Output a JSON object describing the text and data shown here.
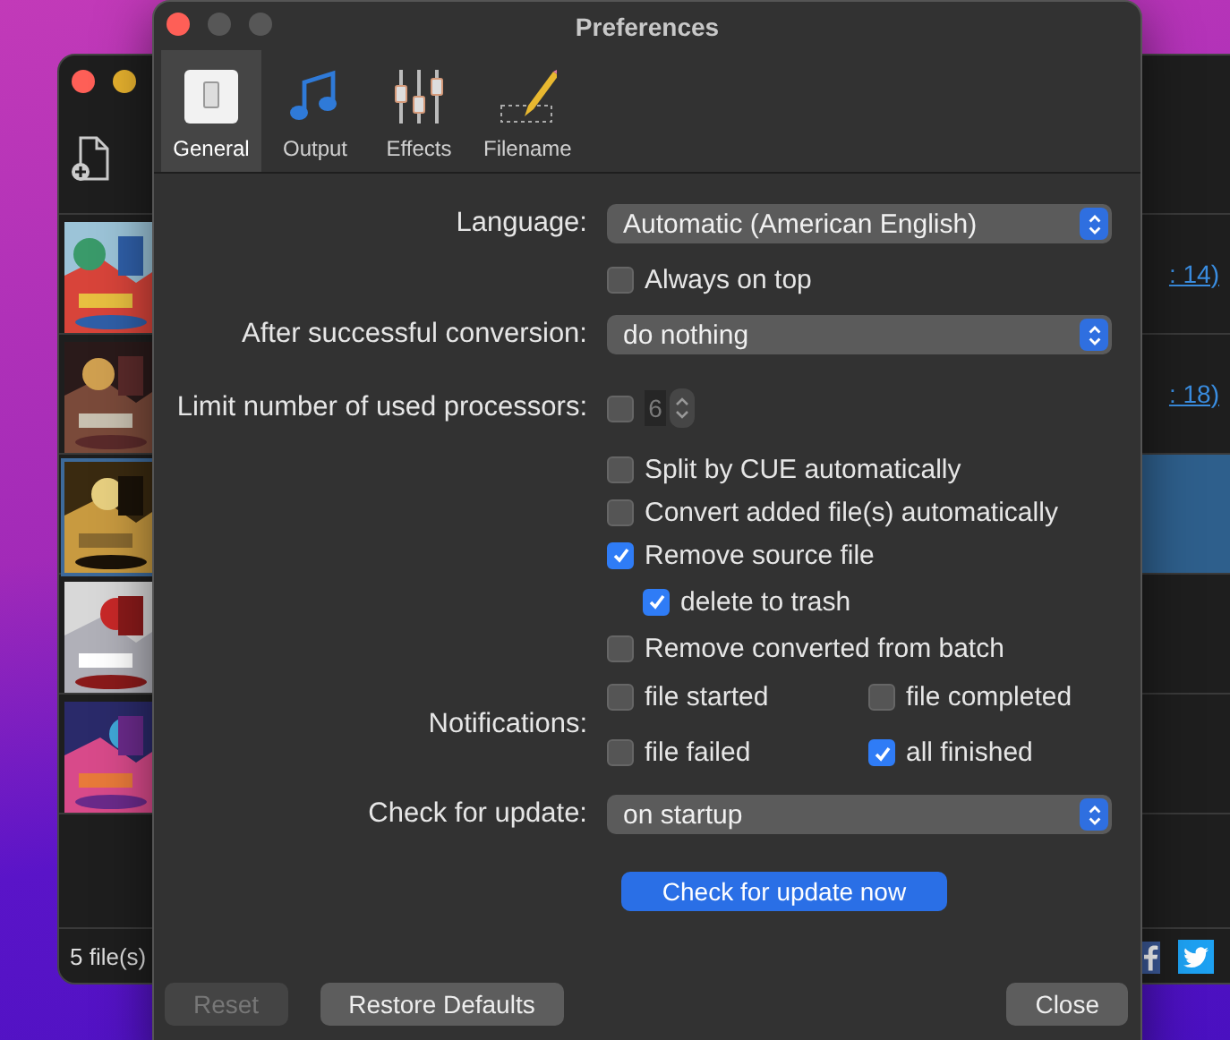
{
  "background_window": {
    "rows": [
      {
        "selected": false,
        "link": ": 14)"
      },
      {
        "selected": false,
        "link": ": 18)"
      },
      {
        "selected": true
      },
      {
        "selected": false
      },
      {
        "selected": false
      }
    ],
    "status": "5 file(s)"
  },
  "preferences": {
    "title": "Preferences",
    "tabs": [
      {
        "label": "General",
        "selected": true
      },
      {
        "label": "Output",
        "selected": false
      },
      {
        "label": "Effects",
        "selected": false
      },
      {
        "label": "Filename",
        "selected": false
      }
    ],
    "settings": [
      {
        "kind": "popup",
        "label": "Language:",
        "value": "Automatic (American English)"
      },
      {
        "kind": "checkbox",
        "text": "Always on top",
        "checked": false
      },
      {
        "kind": "popup",
        "label": "After successful conversion:",
        "value": "do nothing"
      },
      {
        "kind": "stepper",
        "label": "Limit number of used processors:",
        "checked": false,
        "value": "6",
        "disabled": true
      },
      {
        "kind": "checkbox",
        "text": "Split by CUE automatically",
        "checked": false
      },
      {
        "kind": "checkbox",
        "text": "Convert added file(s) automatically",
        "checked": false
      },
      {
        "kind": "checkbox",
        "text": "Remove source file",
        "checked": true,
        "children": [
          {
            "kind": "checkbox",
            "text": "delete to trash",
            "checked": true
          }
        ]
      },
      {
        "kind": "checkbox",
        "text": "Remove converted from batch",
        "checked": false
      },
      {
        "kind": "checkgrid",
        "label": "Notifications:",
        "options": [
          {
            "text": "file started",
            "checked": false
          },
          {
            "text": "file completed",
            "checked": false
          },
          {
            "text": "file failed",
            "checked": false
          },
          {
            "text": "all finished",
            "checked": true
          }
        ]
      },
      {
        "kind": "popup",
        "label": "Check for update:",
        "value": "on startup"
      },
      {
        "kind": "button",
        "text": "Check for update now"
      }
    ],
    "footer_buttons": [
      {
        "text": "Reset",
        "disabled": true
      },
      {
        "text": "Restore Defaults",
        "disabled": false
      },
      {
        "text": "Close",
        "disabled": false
      }
    ]
  }
}
